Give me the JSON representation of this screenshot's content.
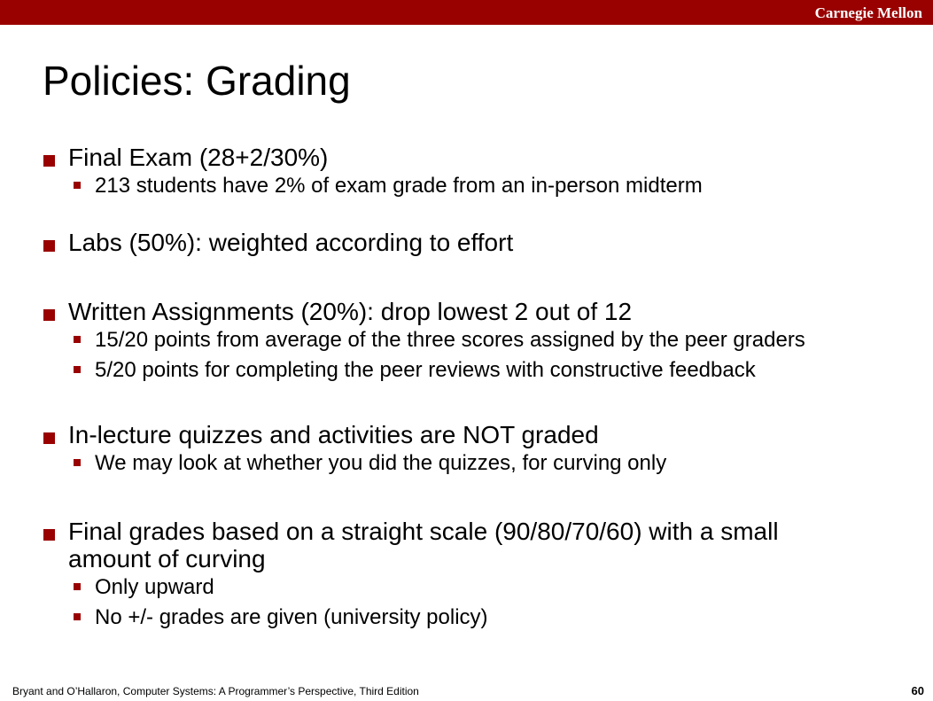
{
  "header": {
    "brand": "Carnegie Mellon"
  },
  "slide": {
    "title": "Policies: Grading",
    "sections": [
      {
        "text": "Final Exam (28+2/30%)",
        "subs": [
          "213 students have 2% of exam grade from an in-person midterm"
        ]
      },
      {
        "text": "Labs (50%): weighted according to effort",
        "subs": []
      },
      {
        "text": "Written Assignments (20%): drop lowest 2 out of 12",
        "subs": [
          "15/20 points from average of the three scores assigned by the peer graders",
          "5/20 points for completing the peer reviews with constructive feedback"
        ]
      },
      {
        "text": "In-lecture quizzes and activities are NOT graded",
        "subs": [
          "We may look at whether you did the quizzes, for curving only"
        ]
      },
      {
        "text": "Final grades based on a straight scale (90/80/70/60) with a small amount of curving",
        "subs": [
          "Only upward",
          "No +/- grades are given (university policy)"
        ]
      }
    ]
  },
  "footer": {
    "citation": "Bryant and O’Hallaron, Computer Systems: A Programmer’s Perspective, Third Edition",
    "page_number": "60"
  },
  "colors": {
    "accent": "#990000",
    "text": "#000000",
    "background": "#ffffff"
  }
}
